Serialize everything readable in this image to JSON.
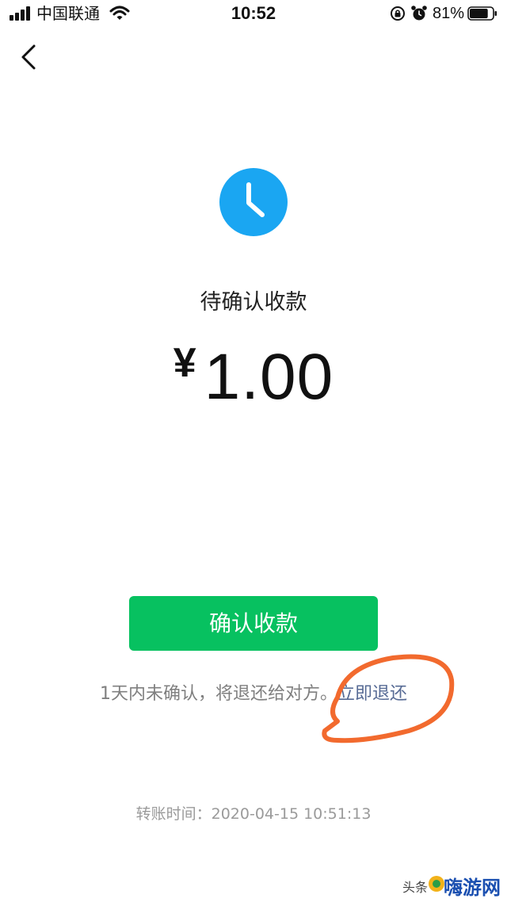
{
  "status_bar": {
    "carrier": "中国联通",
    "time": "10:52",
    "battery": "81%",
    "battery_level": 0.81
  },
  "page": {
    "status_title": "待确认收款",
    "currency_symbol": "¥",
    "amount": "1.00",
    "confirm_button_label": "确认收款",
    "notice_text": "1天内未确认，将退还给对方。",
    "refund_link_label": "立即退还",
    "transfer_time_label": "转账时间：",
    "transfer_time_value": "2020-04-15 10:51:13"
  },
  "watermark": {
    "prefix": "头条",
    "brand": "嗨游网"
  },
  "colors": {
    "accent_green": "#07c160",
    "pending_blue": "#1aa6f2",
    "link_blue": "#576b95",
    "annotation_orange": "#f26a2e"
  },
  "icons": [
    "back-arrow-icon",
    "clock-icon",
    "signal-icon",
    "wifi-icon",
    "orientation-lock-icon",
    "alarm-icon",
    "battery-icon"
  ]
}
